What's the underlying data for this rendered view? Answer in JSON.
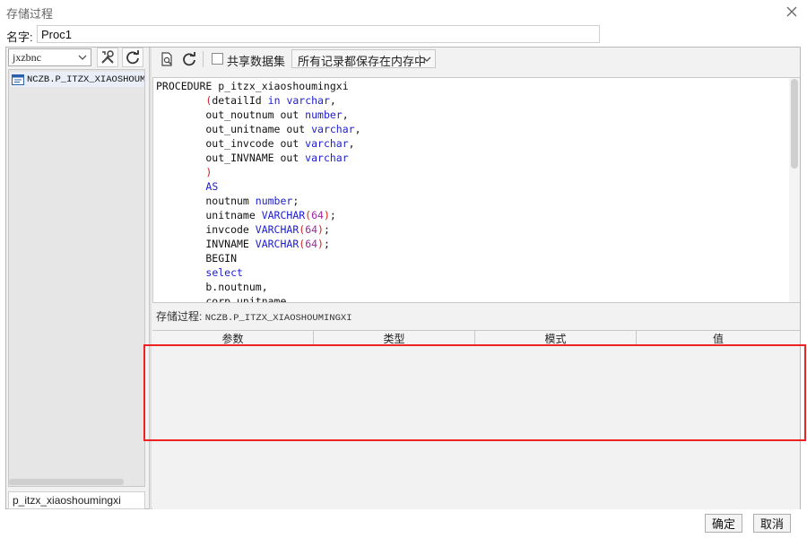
{
  "window": {
    "title": "存储过程"
  },
  "name_field": {
    "label": "名字:",
    "value": "Proc1"
  },
  "left_panel": {
    "schema_select": "jxzbnc",
    "tree_items": [
      {
        "label": "NCZB.P_ITZX_XIAOSHOUMI",
        "icon": "procedure-icon"
      }
    ],
    "search_value": "p_itzx_xiaoshoumingxi"
  },
  "toolbar": {
    "share_label": "共享数据集",
    "share_checked": false,
    "mode_select": "所有记录都保存在内存中"
  },
  "editor": {
    "lines": [
      [
        {
          "t": "PROCEDURE p_itzx_xiaoshoumingxi",
          "c": ""
        }
      ],
      [
        {
          "t": "        ",
          "c": ""
        },
        {
          "t": "(",
          "c": "par"
        },
        {
          "t": "detailId ",
          "c": ""
        },
        {
          "t": "in",
          "c": "kw"
        },
        {
          "t": " ",
          "c": ""
        },
        {
          "t": "varchar",
          "c": "kw"
        },
        {
          "t": ",",
          "c": ""
        }
      ],
      [
        {
          "t": "        out_noutnum out ",
          "c": ""
        },
        {
          "t": "number",
          "c": "kw"
        },
        {
          "t": ",",
          "c": ""
        }
      ],
      [
        {
          "t": "        out_unitname out ",
          "c": ""
        },
        {
          "t": "varchar",
          "c": "kw"
        },
        {
          "t": ",",
          "c": ""
        }
      ],
      [
        {
          "t": "        out_invcode out ",
          "c": ""
        },
        {
          "t": "varchar",
          "c": "kw"
        },
        {
          "t": ",",
          "c": ""
        }
      ],
      [
        {
          "t": "        out_INVNAME out ",
          "c": ""
        },
        {
          "t": "varchar",
          "c": "kw"
        }
      ],
      [
        {
          "t": "        ",
          "c": ""
        },
        {
          "t": ")",
          "c": "par"
        }
      ],
      [
        {
          "t": "        ",
          "c": ""
        },
        {
          "t": "AS",
          "c": "kw"
        }
      ],
      [
        {
          "t": "        noutnum ",
          "c": ""
        },
        {
          "t": "number",
          "c": "kw"
        },
        {
          "t": ";",
          "c": ""
        }
      ],
      [
        {
          "t": "        unitname ",
          "c": ""
        },
        {
          "t": "VARCHAR",
          "c": "kw"
        },
        {
          "t": "(",
          "c": "par"
        },
        {
          "t": "64",
          "c": "num"
        },
        {
          "t": ")",
          "c": "par"
        },
        {
          "t": ";",
          "c": ""
        }
      ],
      [
        {
          "t": "        invcode ",
          "c": ""
        },
        {
          "t": "VARCHAR",
          "c": "kw"
        },
        {
          "t": "(",
          "c": "par"
        },
        {
          "t": "64",
          "c": "num"
        },
        {
          "t": ")",
          "c": "par"
        },
        {
          "t": ";",
          "c": ""
        }
      ],
      [
        {
          "t": "        INVNAME ",
          "c": ""
        },
        {
          "t": "VARCHAR",
          "c": "kw"
        },
        {
          "t": "(",
          "c": "par"
        },
        {
          "t": "64",
          "c": "num"
        },
        {
          "t": ")",
          "c": "par"
        },
        {
          "t": ";",
          "c": ""
        }
      ],
      [
        {
          "t": "        BEGIN",
          "c": ""
        }
      ],
      [
        {
          "t": "        ",
          "c": ""
        },
        {
          "t": "select",
          "c": "kw"
        }
      ],
      [
        {
          "t": "        b.noutnum,",
          "c": ""
        }
      ],
      [
        {
          "t": "        corp_unitname",
          "c": ""
        }
      ]
    ]
  },
  "procedure_caption": {
    "label": "存储过程:",
    "name": "NCZB.P_ITZX_XIAOSHOUMINGXI"
  },
  "param_table": {
    "columns": [
      "参数",
      "类型",
      "模式",
      "值"
    ],
    "rows": []
  },
  "footer": {
    "ok_label": "确定",
    "cancel_label": "取消"
  },
  "colors": {
    "highlight": "#ee2222",
    "keyword": "#1c1cd2",
    "paren": "#d21c1c",
    "number": "#9c2a9c"
  }
}
